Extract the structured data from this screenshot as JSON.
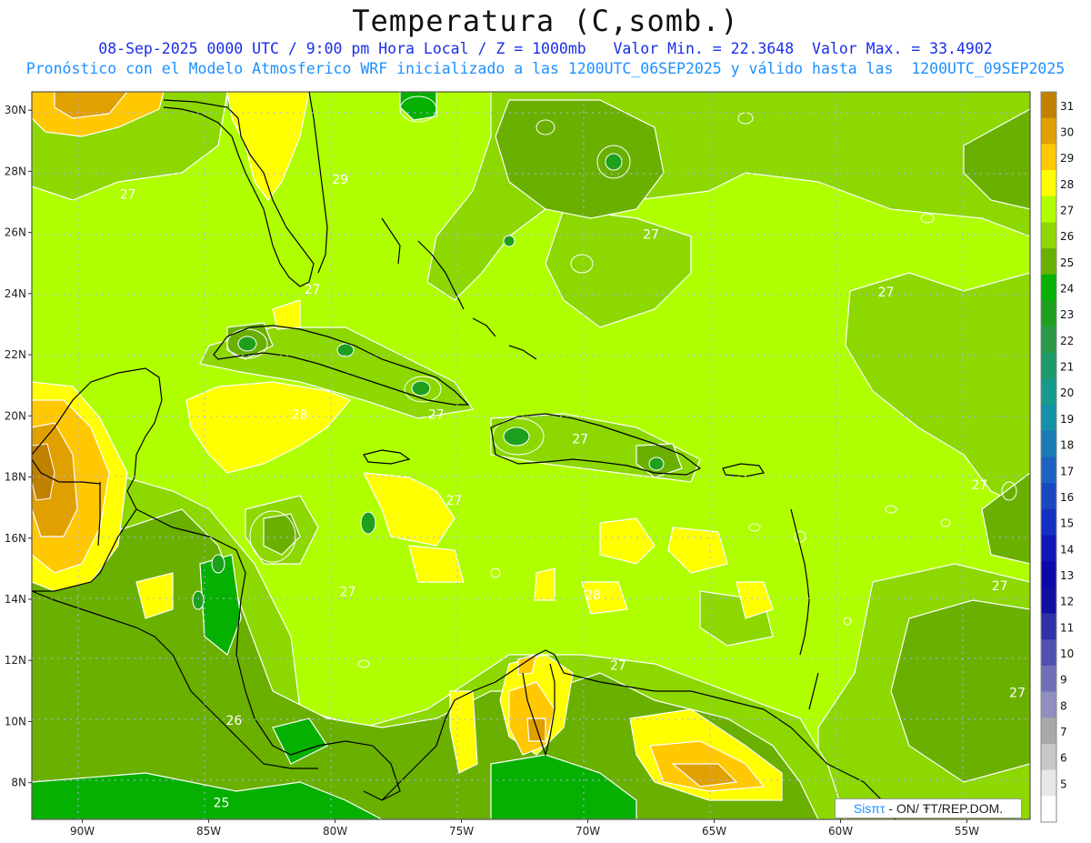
{
  "title": "Temperatura (C,somb.)",
  "subtitle_line1": "08-Sep-2025 0000 UTC / 9:00 pm Hora Local / Z = 1000mb   Valor Min. = 22.3648  Valor Max. = 33.4902",
  "subtitle_line2": "Pronóstico con el Modelo Atmosferico WRF inicializado a las 1200UTC_06SEP2025 y válido hasta las  1200UTC_09SEP2025",
  "map": {
    "lon_range": [
      -92,
      -52.5
    ],
    "lat_range": [
      6.8,
      30.6
    ],
    "lat_ticks": [
      "30N",
      "28N",
      "26N",
      "24N",
      "22N",
      "20N",
      "18N",
      "16N",
      "14N",
      "12N",
      "10N",
      "8N"
    ],
    "lon_ticks": [
      "90W",
      "85W",
      "80W",
      "75W",
      "70W",
      "65W",
      "60W",
      "55W"
    ],
    "contour_labels": [
      {
        "text": "27",
        "lon": -88.2,
        "lat": 27.1
      },
      {
        "text": "29",
        "lon": -79.8,
        "lat": 27.6
      },
      {
        "text": "27",
        "lon": -67.5,
        "lat": 25.8
      },
      {
        "text": "27",
        "lon": -80.9,
        "lat": 24.0
      },
      {
        "text": "27",
        "lon": -58.2,
        "lat": 23.9
      },
      {
        "text": "28",
        "lon": -81.4,
        "lat": 19.9
      },
      {
        "text": "27",
        "lon": -76.0,
        "lat": 19.9
      },
      {
        "text": "27",
        "lon": -70.3,
        "lat": 19.1
      },
      {
        "text": "27",
        "lon": -75.3,
        "lat": 17.1
      },
      {
        "text": "27",
        "lon": -54.5,
        "lat": 17.6
      },
      {
        "text": "27",
        "lon": -79.5,
        "lat": 14.1
      },
      {
        "text": "28",
        "lon": -69.8,
        "lat": 14.0
      },
      {
        "text": "27",
        "lon": -53.7,
        "lat": 14.3
      },
      {
        "text": "27",
        "lon": -68.8,
        "lat": 11.7
      },
      {
        "text": "27",
        "lon": -53.0,
        "lat": 10.8
      },
      {
        "text": "26",
        "lon": -84.0,
        "lat": 9.9
      },
      {
        "text": "25",
        "lon": -84.5,
        "lat": 7.2
      }
    ]
  },
  "colorbar": {
    "levels": [
      "31",
      "30",
      "29",
      "28",
      "27",
      "26",
      "25",
      "24",
      "23",
      "22",
      "21",
      "20",
      "19",
      "18",
      "17",
      "16",
      "15",
      "14",
      "13",
      "12",
      "11",
      "10",
      "9",
      "8",
      "7",
      "6",
      "5"
    ],
    "colors": [
      "#c08000",
      "#e0a000",
      "#ffc800",
      "#ffff00",
      "#b0ff00",
      "#8cd800",
      "#6ab000",
      "#06b000",
      "#1ea01e",
      "#2a9a4a",
      "#1e9a6a",
      "#169a8c",
      "#1490a8",
      "#1a7ab8",
      "#1e62c0",
      "#1a48c0",
      "#1430c0",
      "#1018b8",
      "#0c08a8",
      "#1010a0",
      "#3030a8",
      "#5050b0",
      "#7070b8",
      "#9090c0",
      "#a8a8a8",
      "#c8c8c8",
      "#e8e8e8",
      "#ffffff"
    ]
  },
  "credit": {
    "brand": "Sisπτ",
    "rest": " - ON/ ŦT/REP.DOM."
  }
}
